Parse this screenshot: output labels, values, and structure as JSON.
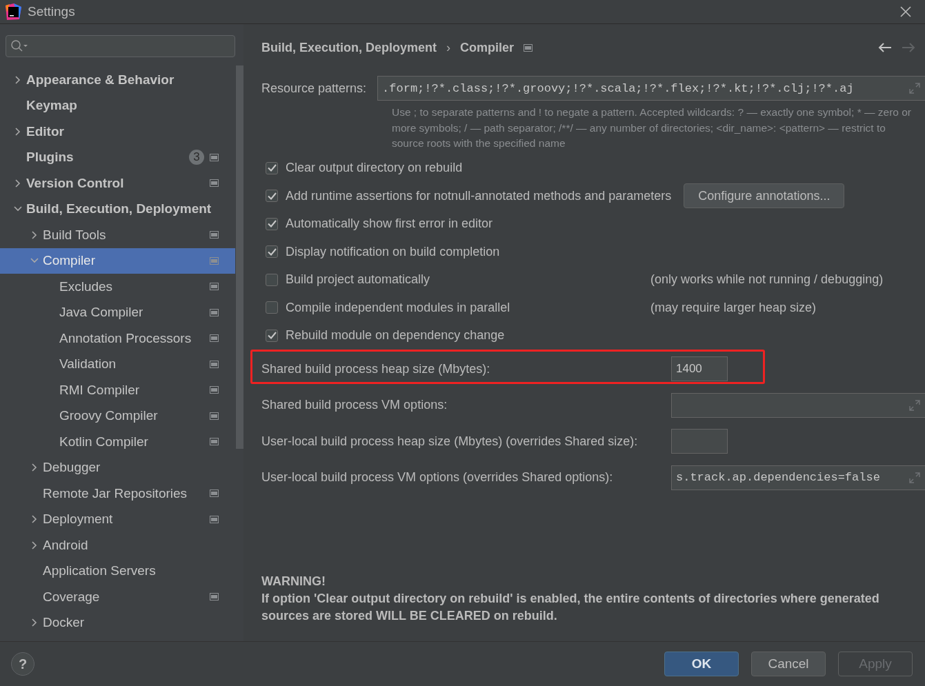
{
  "window": {
    "title": "Settings"
  },
  "sidebar": {
    "items": [
      {
        "label": "Appearance & Behavior",
        "expanded": false,
        "selected": false
      },
      {
        "label": "Keymap",
        "selected": false
      },
      {
        "label": "Editor",
        "expanded": false,
        "selected": false
      },
      {
        "label": "Plugins",
        "badge": "3",
        "project_icon": true,
        "selected": false
      },
      {
        "label": "Version Control",
        "expanded": false,
        "project_icon": true,
        "selected": false
      },
      {
        "label": "Build, Execution, Deployment",
        "expanded": true,
        "selected": false,
        "children": [
          {
            "label": "Build Tools",
            "expanded": false,
            "project_icon": true,
            "selected": false
          },
          {
            "label": "Compiler",
            "expanded": true,
            "project_icon": true,
            "selected": true,
            "children": [
              {
                "label": "Excludes",
                "project_icon": true,
                "selected": false
              },
              {
                "label": "Java Compiler",
                "project_icon": true,
                "selected": false
              },
              {
                "label": "Annotation Processors",
                "project_icon": true,
                "selected": false
              },
              {
                "label": "Validation",
                "project_icon": true,
                "selected": false
              },
              {
                "label": "RMI Compiler",
                "project_icon": true,
                "selected": false
              },
              {
                "label": "Groovy Compiler",
                "project_icon": true,
                "selected": false
              },
              {
                "label": "Kotlin Compiler",
                "project_icon": true,
                "selected": false
              }
            ]
          },
          {
            "label": "Debugger",
            "expanded": false,
            "selected": false
          },
          {
            "label": "Remote Jar Repositories",
            "project_icon": true,
            "selected": false
          },
          {
            "label": "Deployment",
            "expanded": false,
            "project_icon": true,
            "selected": false
          },
          {
            "label": "Android",
            "expanded": false,
            "selected": false
          },
          {
            "label": "Application Servers",
            "selected": false
          },
          {
            "label": "Coverage",
            "project_icon": true,
            "selected": false
          },
          {
            "label": "Docker",
            "expanded": false,
            "selected": false
          }
        ]
      }
    ]
  },
  "breadcrumb": {
    "items": [
      "Build, Execution, Deployment",
      "Compiler"
    ],
    "separator": "›"
  },
  "resource_patterns": {
    "label": "Resource patterns:",
    "value": ".form;!?*.class;!?*.groovy;!?*.scala;!?*.flex;!?*.kt;!?*.clj;!?*.aj",
    "hint": "Use ; to separate patterns and ! to negate a pattern. Accepted wildcards: ? — exactly one symbol; * — zero or more symbols; / — path separator; /**/ — any number of directories; <dir_name>: <pattern> — restrict to source roots with the specified name"
  },
  "options": [
    {
      "label": "Clear output directory on rebuild",
      "checked": true
    },
    {
      "label": "Add runtime assertions for notnull-annotated methods and parameters",
      "checked": true,
      "button": "Configure annotations..."
    },
    {
      "label": "Automatically show first error in editor",
      "checked": true
    },
    {
      "label": "Display notification on build completion",
      "checked": true
    },
    {
      "label": "Build project automatically",
      "checked": false,
      "note": "(only works while not running / debugging)"
    },
    {
      "label": "Compile independent modules in parallel",
      "checked": false,
      "note": "(may require larger heap size)"
    },
    {
      "label": "Rebuild module on dependency change",
      "checked": true
    }
  ],
  "vm_fields": [
    {
      "kind": "number",
      "label": "Shared build process heap size (Mbytes):",
      "value": "1400",
      "highlighted": true
    },
    {
      "kind": "text",
      "label": "Shared build process VM options:",
      "highlighted": false
    },
    {
      "kind": "number",
      "label": "User-local build process heap size (Mbytes) (overrides Shared size):",
      "highlighted": false
    },
    {
      "kind": "text",
      "label": "User-local build process VM options (overrides Shared options):",
      "value": "s.track.ap.dependencies=false",
      "highlighted": false
    }
  ],
  "warning": {
    "title": "WARNING!",
    "text": "If option 'Clear output directory on rebuild' is enabled, the entire contents of directories where generated sources are stored WILL BE CLEARED on rebuild."
  },
  "help_button": {
    "label": "?"
  },
  "buttons": [
    {
      "label": "OK",
      "default": true,
      "disabled": false
    },
    {
      "label": "Cancel",
      "default": false,
      "disabled": false
    },
    {
      "label": "Apply",
      "default": false,
      "disabled": true
    }
  ]
}
